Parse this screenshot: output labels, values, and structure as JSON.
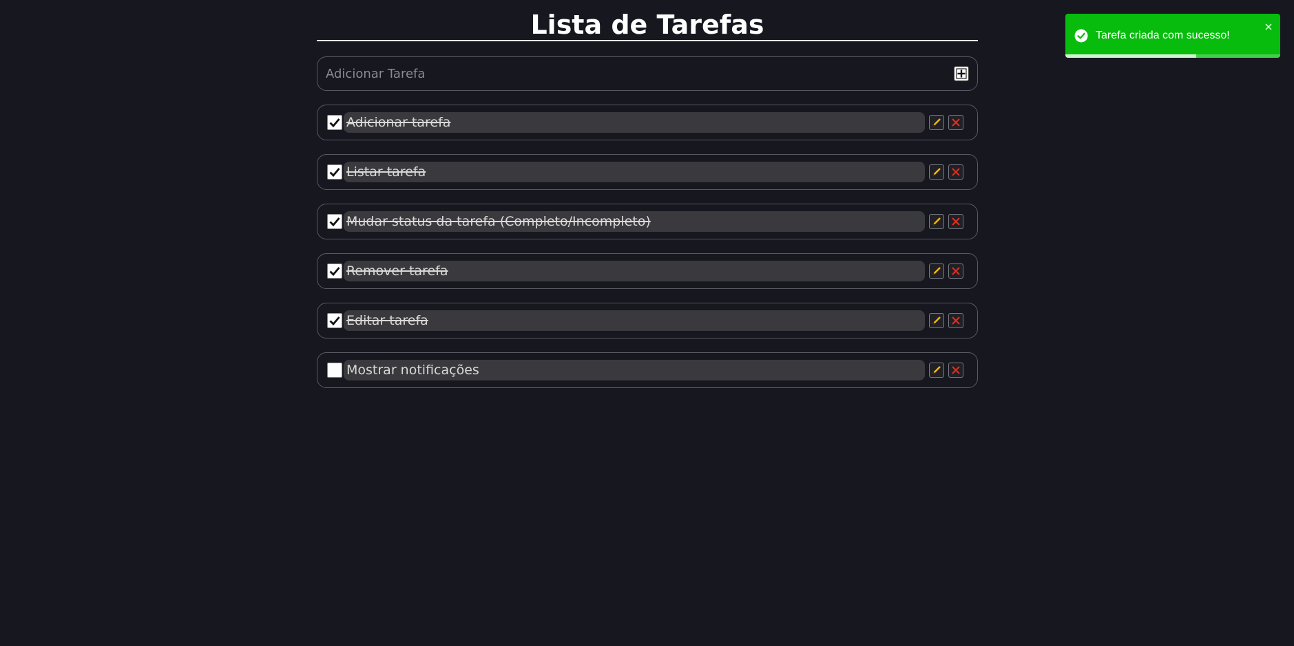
{
  "header": {
    "title": "Lista de Tarefas"
  },
  "add_task": {
    "placeholder": "Adicionar Tarefa",
    "value": "",
    "button_icon": "plus-icon"
  },
  "tasks": [
    {
      "label": "Adicionar tarefa",
      "completed": true
    },
    {
      "label": "Listar tarefa",
      "completed": true
    },
    {
      "label": "Mudar status da tarefa (Completo/Incompleto)",
      "completed": true
    },
    {
      "label": "Remover tarefa",
      "completed": true
    },
    {
      "label": "Editar tarefa",
      "completed": true
    },
    {
      "label": "Mostrar notificações",
      "completed": false
    }
  ],
  "task_actions": {
    "edit_icon": "pencil-icon",
    "delete_icon": "close-icon"
  },
  "toast": {
    "message": "Tarefa criada com sucesso!",
    "icon": "check-circle-icon",
    "close_icon": "close-icon",
    "progress": 0.61
  },
  "colors": {
    "background": "#17171f",
    "toast_success": "#07bc0c",
    "edit_accent": "#f5b800",
    "delete_accent": "#e0301e"
  }
}
